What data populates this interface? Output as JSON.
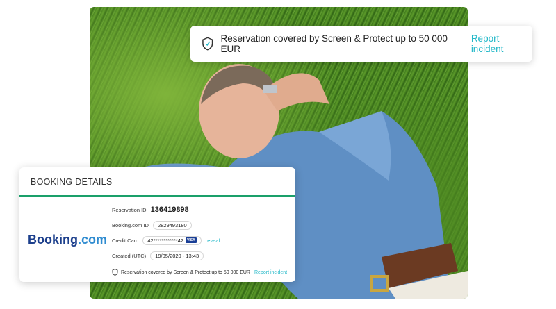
{
  "notice": {
    "text": "Reservation covered by Screen & Protect up to 50 000 EUR",
    "link": "Report incident"
  },
  "booking": {
    "header": "BOOKING DETAILS",
    "logo_main": "Booking",
    "logo_suffix": ".com",
    "reservation_label": "Reservation ID",
    "reservation_value": "136419898",
    "booking_id_label": "Booking.com ID",
    "booking_id_value": "2829493180",
    "credit_card_label": "Credit Card",
    "credit_card_value": "42************42",
    "card_brand": "VISA",
    "reveal": "reveal",
    "created_label": "Created (UTC)",
    "created_value": "19/05/2020 - 13:43",
    "footer_text": "Reservation covered by Screen & Protect up to 50 000 EUR",
    "footer_link": "Report incident"
  },
  "colors": {
    "accent": "#22b8c8",
    "divider": "#1aa06a",
    "booking_blue": "#1c3f8c"
  }
}
